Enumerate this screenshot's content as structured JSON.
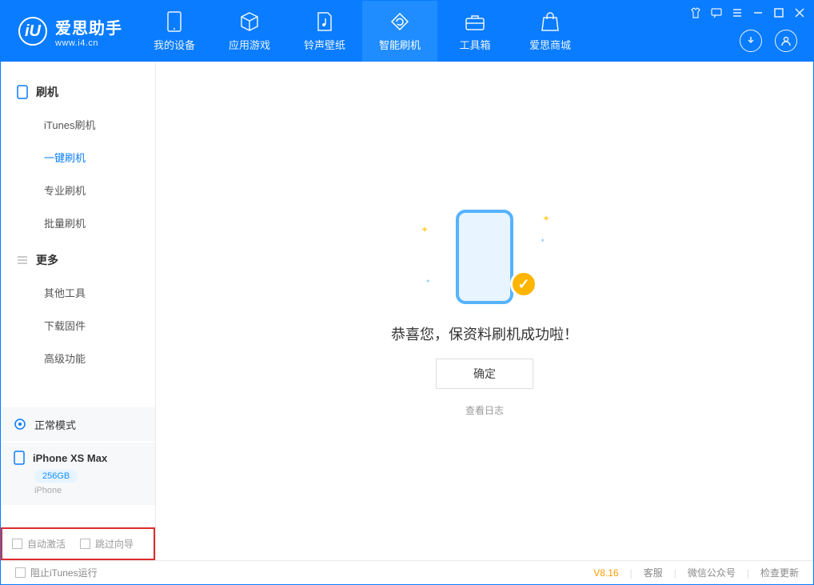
{
  "app": {
    "name_cn": "爱思助手",
    "url": "www.i4.cn"
  },
  "tabs": [
    {
      "label": "我的设备"
    },
    {
      "label": "应用游戏"
    },
    {
      "label": "铃声壁纸"
    },
    {
      "label": "智能刷机"
    },
    {
      "label": "工具箱"
    },
    {
      "label": "爱思商城"
    }
  ],
  "sidebar": {
    "group1": {
      "title": "刷机",
      "items": [
        "iTunes刷机",
        "一键刷机",
        "专业刷机",
        "批量刷机"
      ]
    },
    "group2": {
      "title": "更多",
      "items": [
        "其他工具",
        "下载固件",
        "高级功能"
      ]
    }
  },
  "device": {
    "mode": "正常模式",
    "name": "iPhone XS Max",
    "capacity": "256GB",
    "type": "iPhone"
  },
  "options": {
    "auto_activate": "自动激活",
    "skip_guide": "跳过向导"
  },
  "main": {
    "success": "恭喜您，保资料刷机成功啦！",
    "ok": "确定",
    "view_log": "查看日志"
  },
  "footer": {
    "block_itunes": "阻止iTunes运行",
    "version": "V8.16",
    "support": "客服",
    "wechat": "微信公众号",
    "update": "检查更新"
  }
}
